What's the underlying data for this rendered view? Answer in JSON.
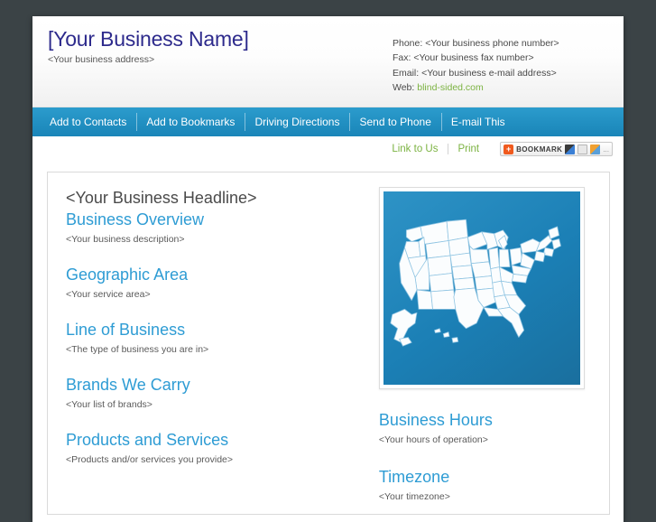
{
  "header": {
    "business_name": "[Your Business Name]",
    "business_address": "<Your business address>",
    "contact": {
      "phone": "Phone: <Your business phone number>",
      "fax": "Fax: <Your business fax number>",
      "email": "Email: <Your business e-mail address>",
      "web_label": "Web: ",
      "web_link": "blind-sided.com"
    }
  },
  "nav": {
    "items": [
      {
        "label": "Add to Contacts"
      },
      {
        "label": "Add to Bookmarks"
      },
      {
        "label": "Driving Directions"
      },
      {
        "label": "Send to Phone"
      },
      {
        "label": "E-mail This"
      }
    ]
  },
  "toolbar": {
    "link_to_us": "Link to Us",
    "print": "Print",
    "bookmark_plus": "+",
    "bookmark_label": "BOOKMARK",
    "bookmark_ellipsis": "..."
  },
  "main": {
    "headline": "<Your Business Headline>",
    "left_sections": [
      {
        "title": "Business Overview",
        "body": "<Your business description>"
      },
      {
        "title": "Geographic Area",
        "body": "<Your service area>"
      },
      {
        "title": "Line of Business",
        "body": "<The type of business you are in>"
      },
      {
        "title": "Brands We Carry",
        "body": "<Your list of brands>"
      },
      {
        "title": "Products and Services",
        "body": "<Products and/or services you provide>"
      }
    ],
    "right_sections": [
      {
        "title": "Business Hours",
        "body": "<Your hours of operation>"
      },
      {
        "title": "Timezone",
        "body": "<Your timezone>"
      }
    ],
    "map_alt": "united-states-map"
  },
  "colors": {
    "page_background": "#3b4346",
    "accent_blue": "#2e9cd4",
    "nav_blue": "#2290c2",
    "link_green": "#7cb342",
    "brand_navy": "#2d2a8c",
    "body_text": "#5a5a5a"
  }
}
